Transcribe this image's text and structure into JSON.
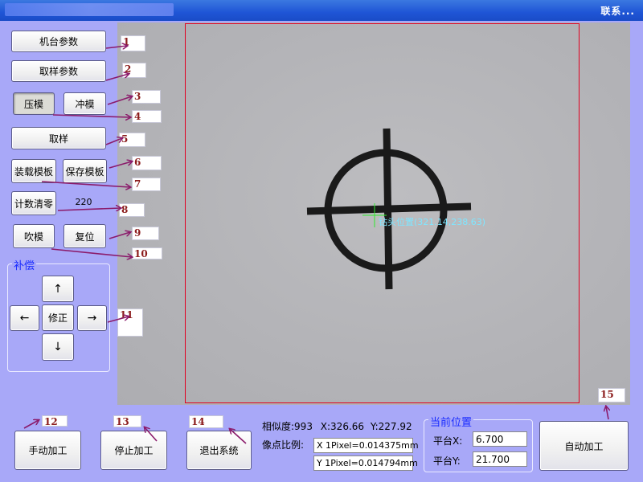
{
  "window": {
    "title_link": "联系..."
  },
  "buttons": {
    "machine_params": "机台参数",
    "sample_params": "取样参数",
    "press_mold": "压模",
    "punch_mold": "冲模",
    "sample": "取样",
    "load_template": "装载模板",
    "save_template": "保存模板",
    "count_reset": "计数清零",
    "blow_mold": "吹模",
    "reset": "复位",
    "manual": "手动加工",
    "stop": "停止加工",
    "exit": "退出系统",
    "auto": "自动加工"
  },
  "counter": {
    "value": "220"
  },
  "compensation": {
    "title": "补偿",
    "up": "↑",
    "left": "←",
    "correct": "修正",
    "right": "→",
    "down": "↓"
  },
  "badges": [
    "1",
    "2",
    "3",
    "4",
    "5",
    "6",
    "7",
    "8",
    "9",
    "10",
    "11",
    "12",
    "13",
    "14",
    "15"
  ],
  "camera": {
    "drill_label": "钻头位置(321.14,238.63)"
  },
  "status": {
    "similarity_label": "相似度:",
    "similarity_value": "993",
    "x_label": "X:",
    "x_value": "326.66",
    "y_label": "Y:",
    "y_value": "227.92",
    "ratio_label": "像点比例:",
    "x_ratio": "X 1Pixel=0.014375mm",
    "y_ratio": "Y 1Pixel=0.014794mm"
  },
  "position": {
    "title": "当前位置",
    "x_label": "平台X:",
    "x_value": "6.700",
    "y_label": "平台Y:",
    "y_value": "21.700"
  },
  "colors": {
    "background": "#a8a8f8",
    "roi_border": "#e00020",
    "annotation": "#8b1b1b",
    "cursor": "#2eea2e",
    "group_title": "#1a2cff"
  }
}
